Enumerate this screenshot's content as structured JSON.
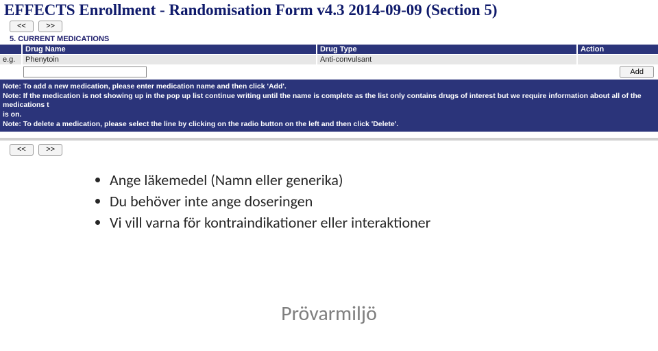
{
  "title": "EFFECTS Enrollment - Randomisation Form v4.3 2014-09-09 (Section 5)",
  "nav": {
    "prev": "<<",
    "next": ">>"
  },
  "section": {
    "heading": "5. CURRENT MEDICATIONS"
  },
  "table": {
    "headers": {
      "num": "",
      "name": "Drug Name",
      "type": "Drug Type",
      "action": "Action"
    },
    "example": {
      "eg": "e.g.",
      "name": "Phenytoin",
      "type": "Anti-convulsant",
      "action": ""
    },
    "addButton": "Add"
  },
  "notes": [
    "Note: To add a new medication, please enter medication name and then click 'Add'.",
    "Note: If the medication is not showing up in the pop up list continue writing until the name is complete as the list only contains drugs of interest but we require information about all of the medications t",
    "is on.",
    "Note: To delete a medication, please select the line by clicking on the radio button on the left and then click 'Delete'."
  ],
  "bullets": [
    "Ange läkemedel (Namn eller generika)",
    "Du behöver inte ange doseringen",
    "Vi vill varna för kontraindikationer eller interaktioner"
  ],
  "footer": "Prövarmiljö"
}
